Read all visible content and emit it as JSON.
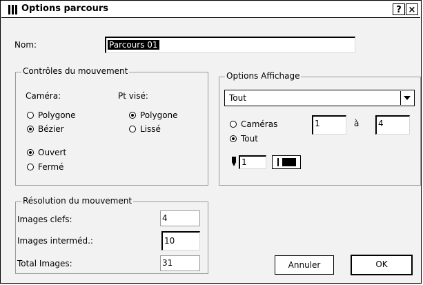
{
  "window": {
    "title": "Options parcours",
    "help_label": "?",
    "close_label": "×"
  },
  "nom": {
    "label": "Nom:",
    "value": "Parcours 01"
  },
  "controles": {
    "title": "Contrôles du mouvement",
    "camera_label": "Caméra:",
    "ptvise_label": "Pt visé:",
    "camera_options": [
      {
        "label": "Polygone",
        "checked": false
      },
      {
        "label": "Bézier",
        "checked": true
      }
    ],
    "ptvise_options": [
      {
        "label": "Polygone",
        "checked": true
      },
      {
        "label": "Lissé",
        "checked": false
      }
    ],
    "path_options": [
      {
        "label": "Ouvert",
        "checked": true
      },
      {
        "label": "Fermé",
        "checked": false
      }
    ]
  },
  "affichage": {
    "title": "Options Affichage",
    "dropdown_value": "Tout",
    "cameras_label": "Caméras",
    "cameras_checked": false,
    "tout_label": "Tout",
    "tout_checked": true,
    "from_value": "1",
    "a_label": "à",
    "to_value": "4",
    "pen_icon": "pen-icon",
    "line_width_value": "1"
  },
  "resolution": {
    "title": "Résolution du mouvement",
    "images_clefs_label": "Images clefs:",
    "images_clefs_value": "4",
    "images_intermed_label": "Images interméd.:",
    "images_intermed_value": "10",
    "total_images_label": "Total Images:",
    "total_images_value": "31"
  },
  "buttons": {
    "annuler": "Annuler",
    "ok": "OK"
  }
}
